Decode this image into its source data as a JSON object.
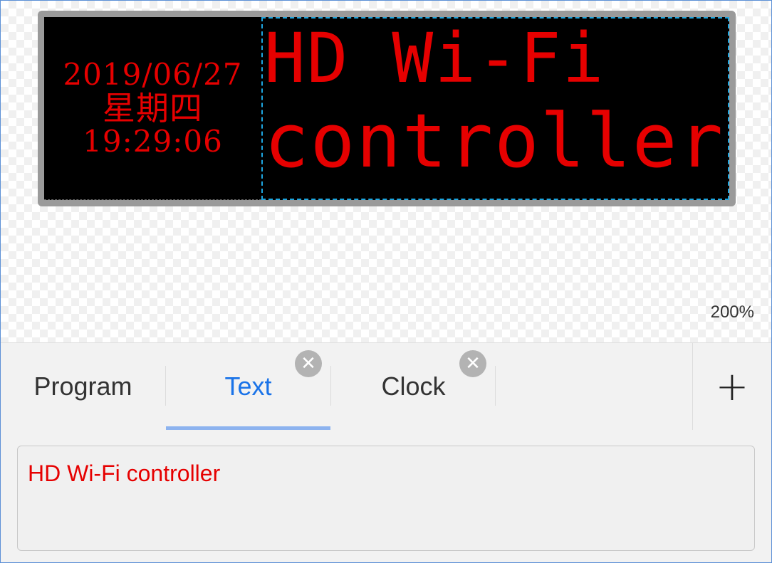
{
  "preview": {
    "clock": {
      "date": "2019/06/27",
      "weekday": "星期四",
      "time": "19:29:06"
    },
    "text_lines": [
      "HD Wi-Fi",
      "controller"
    ],
    "zoom": "200%"
  },
  "tabs": [
    {
      "label": "Program",
      "active": false,
      "closable": false
    },
    {
      "label": "Text",
      "active": true,
      "closable": true
    },
    {
      "label": "Clock",
      "active": false,
      "closable": true
    }
  ],
  "add_icon": "plus-icon",
  "close_icon": "close-icon",
  "text_input": {
    "value": "HD Wi-Fi controller"
  },
  "colors": {
    "led_text": "#e60000",
    "active_tab": "#1a73e8",
    "screen_border": "#9a9a9a",
    "selection": "#1ea7e1"
  }
}
